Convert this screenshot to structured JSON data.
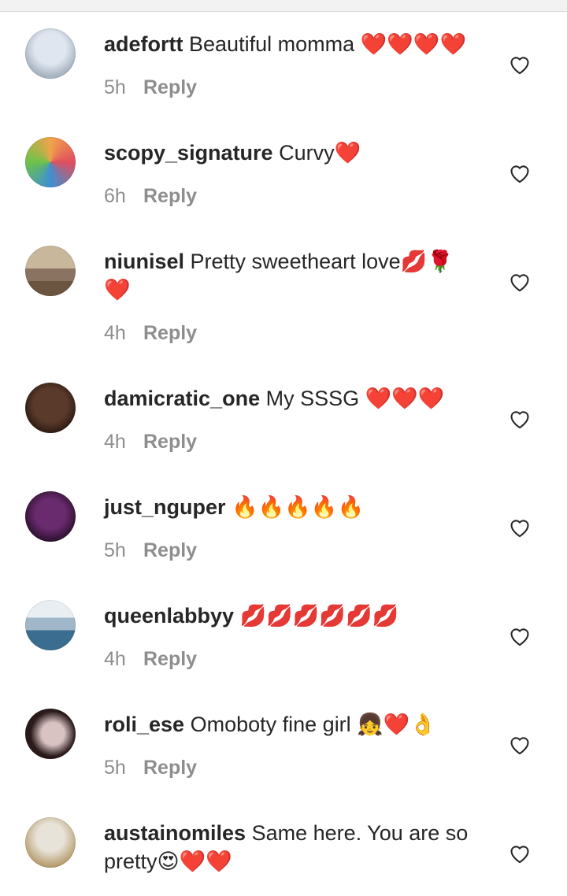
{
  "comments": [
    {
      "username": "adefortt",
      "text": "Beautiful momma ❤️❤️❤️❤️",
      "time": "5h",
      "reply_label": "Reply",
      "avatar_colors": [
        "#dfe6ef",
        "#a9b4c2"
      ]
    },
    {
      "username": "scopy_signature",
      "text": "Curvy❤️",
      "time": "6h",
      "reply_label": "Reply",
      "avatar_colors": [
        "#f0a34a",
        "#3d8fd4"
      ]
    },
    {
      "username": "niunisel",
      "text": "Pretty sweetheart love💋🌹❤️",
      "time": "4h",
      "reply_label": "Reply",
      "avatar_colors": [
        "#c9b79c",
        "#6b5440"
      ]
    },
    {
      "username": "damicratic_one",
      "text": "My SSSG ❤️❤️❤️",
      "time": "4h",
      "reply_label": "Reply",
      "avatar_colors": [
        "#5a3a2a",
        "#2b1a12"
      ]
    },
    {
      "username": "just_nguper",
      "text": "🔥🔥🔥🔥🔥",
      "time": "5h",
      "reply_label": "Reply",
      "avatar_colors": [
        "#6a2a6e",
        "#2a0f2c"
      ]
    },
    {
      "username": "queenlabbyy",
      "text": "💋💋💋💋💋💋",
      "time": "4h",
      "reply_label": "Reply",
      "avatar_colors": [
        "#9fb7c9",
        "#3a6d8f"
      ]
    },
    {
      "username": "roli_ese",
      "text": "Omoboty fine girl 👧❤️👌",
      "time": "5h",
      "reply_label": "Reply",
      "avatar_colors": [
        "#d9c2c2",
        "#2a1a1a"
      ]
    },
    {
      "username": "austainomiles",
      "text": "Same here. You are so pretty😍❤️❤️",
      "time": "",
      "reply_label": "",
      "avatar_colors": [
        "#e8e3d8",
        "#b49a6a"
      ]
    }
  ],
  "icons": {
    "like": "heart-outline-icon"
  },
  "colors": {
    "text": "#262626",
    "muted": "#8e8e8e",
    "background": "#ffffff"
  }
}
